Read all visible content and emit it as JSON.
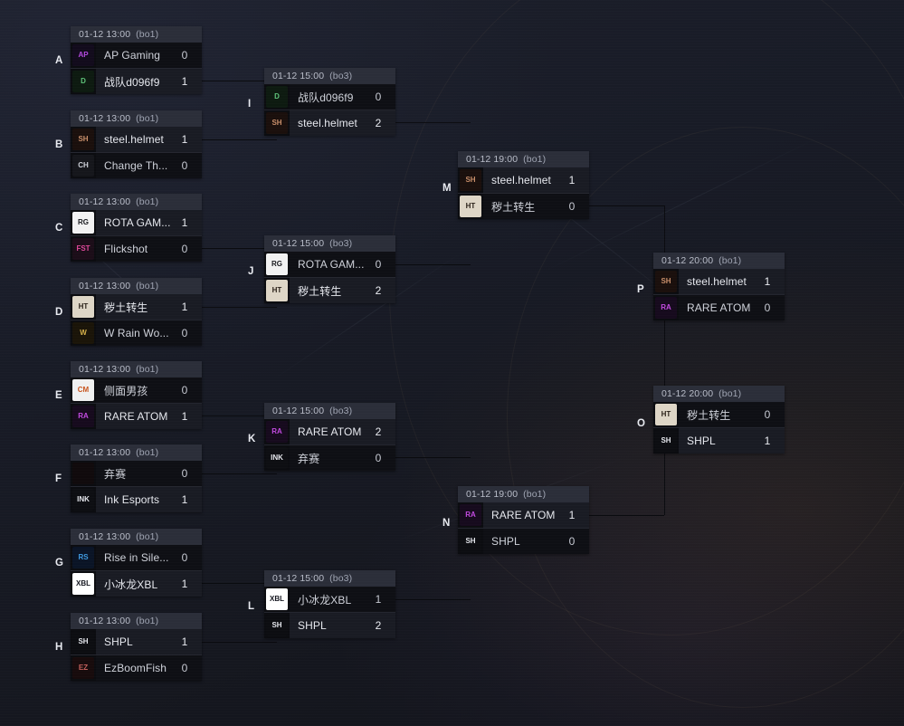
{
  "meta": {
    "view": "tournament-bracket",
    "accent_winner_row": "#191b23",
    "accent_loser_row": "#0e0f14",
    "header_bar": "#2b2e39",
    "background": "#181b26"
  },
  "seed_labels": [
    "A",
    "B",
    "C",
    "D",
    "E",
    "F",
    "G",
    "H"
  ],
  "node_labels": [
    "I",
    "J",
    "K",
    "L",
    "M",
    "N",
    "O",
    "P"
  ],
  "matches": [
    {
      "id": "A",
      "date": "01-12 13:00",
      "format": "(bo1)",
      "teams": [
        {
          "name": "AP Gaming",
          "score": "0",
          "winner": false,
          "logo": "ap-gaming-logo",
          "logo_text": "AP",
          "logo_bg": "#120b1c",
          "logo_fg": "#b44ae0"
        },
        {
          "name": "战队d096f9",
          "score": "1",
          "winner": true,
          "logo": "team-d096f9-logo",
          "logo_text": "D",
          "logo_bg": "#0d1a10",
          "logo_fg": "#5fc47a"
        }
      ]
    },
    {
      "id": "B",
      "date": "01-12 13:00",
      "format": "(bo1)",
      "teams": [
        {
          "name": "steel.helmet",
          "score": "1",
          "winner": true,
          "logo": "steel-helmet-logo",
          "logo_text": "SH",
          "logo_bg": "#1a0f0c",
          "logo_fg": "#c98f6a"
        },
        {
          "name": "Change Th...",
          "score": "0",
          "winner": false,
          "logo": "change-th-logo",
          "logo_text": "CH",
          "logo_bg": "#15161b",
          "logo_fg": "#cfd2da"
        }
      ]
    },
    {
      "id": "C",
      "date": "01-12 13:00",
      "format": "(bo1)",
      "teams": [
        {
          "name": "ROTA GAM...",
          "score": "1",
          "winner": true,
          "logo": "rota-gaming-logo",
          "logo_text": "RG",
          "logo_bg": "#f2f2f2",
          "logo_fg": "#15161b"
        },
        {
          "name": "Flickshot",
          "score": "0",
          "winner": false,
          "logo": "flickshot-logo",
          "logo_text": "FST",
          "logo_bg": "#1b0d18",
          "logo_fg": "#e0489a"
        }
      ]
    },
    {
      "id": "D",
      "date": "01-12 13:00",
      "format": "(bo1)",
      "teams": [
        {
          "name": "秽土转生",
          "score": "1",
          "winner": true,
          "logo": "huitu-zhuansheng-logo",
          "logo_text": "HT",
          "logo_bg": "#ded6c6",
          "logo_fg": "#2a2118"
        },
        {
          "name": "W Rain Wo...",
          "score": "0",
          "winner": false,
          "logo": "w-rain-logo",
          "logo_text": "W",
          "logo_bg": "#1a1408",
          "logo_fg": "#d8b24a"
        }
      ]
    },
    {
      "id": "E",
      "date": "01-12 13:00",
      "format": "(bo1)",
      "teams": [
        {
          "name": "侧面男孩",
          "score": "0",
          "winner": false,
          "logo": "cemian-nanhai-logo",
          "logo_text": "CM",
          "logo_bg": "#f0f0f0",
          "logo_fg": "#c8541e"
        },
        {
          "name": "RARE ATOM",
          "score": "1",
          "winner": true,
          "logo": "rare-atom-logo",
          "logo_text": "RA",
          "logo_bg": "#160a1d",
          "logo_fg": "#c24ae0"
        }
      ]
    },
    {
      "id": "F",
      "date": "01-12 13:00",
      "format": "(bo1)",
      "teams": [
        {
          "name": "弃赛",
          "score": "0",
          "winner": false,
          "logo": "forfeit-bull-logo",
          "logo_text": "",
          "logo_bg": "#100a0c",
          "logo_fg": "#c02334"
        },
        {
          "name": "Ink Esports",
          "score": "1",
          "winner": true,
          "logo": "ink-esports-logo",
          "logo_text": "INK",
          "logo_bg": "#0d0e12",
          "logo_fg": "#e6e8ee"
        }
      ]
    },
    {
      "id": "G",
      "date": "01-12 13:00",
      "format": "(bo1)",
      "teams": [
        {
          "name": "Rise in Sile...",
          "score": "0",
          "winner": false,
          "logo": "rise-in-silence-logo",
          "logo_text": "RS",
          "logo_bg": "#0a1426",
          "logo_fg": "#3f9ae0"
        },
        {
          "name": "小冰龙XBL",
          "score": "1",
          "winner": true,
          "logo": "xbl-logo",
          "logo_text": "XBL",
          "logo_bg": "#ffffff",
          "logo_fg": "#14161f"
        }
      ]
    },
    {
      "id": "H",
      "date": "01-12 13:00",
      "format": "(bo1)",
      "teams": [
        {
          "name": "SHPL",
          "score": "1",
          "winner": true,
          "logo": "shpl-logo",
          "logo_text": "SH",
          "logo_bg": "#0c0d11",
          "logo_fg": "#e6e8ee"
        },
        {
          "name": "EzBoomFish",
          "score": "0",
          "winner": false,
          "logo": "ezboomfish-logo",
          "logo_text": "EZ",
          "logo_bg": "#170b0c",
          "logo_fg": "#c4605c"
        }
      ]
    },
    {
      "id": "I",
      "date": "01-12 15:00",
      "format": "(bo3)",
      "teams": [
        {
          "name": "战队d096f9",
          "score": "0",
          "winner": false,
          "logo": "team-d096f9-logo",
          "logo_text": "D",
          "logo_bg": "#0d1a10",
          "logo_fg": "#5fc47a"
        },
        {
          "name": "steel.helmet",
          "score": "2",
          "winner": true,
          "logo": "steel-helmet-logo",
          "logo_text": "SH",
          "logo_bg": "#1a0f0c",
          "logo_fg": "#c98f6a"
        }
      ]
    },
    {
      "id": "J",
      "date": "01-12 15:00",
      "format": "(bo3)",
      "teams": [
        {
          "name": "ROTA GAM...",
          "score": "0",
          "winner": false,
          "logo": "rota-gaming-logo",
          "logo_text": "RG",
          "logo_bg": "#f2f2f2",
          "logo_fg": "#15161b"
        },
        {
          "name": "秽土转生",
          "score": "2",
          "winner": true,
          "logo": "huitu-zhuansheng-logo",
          "logo_text": "HT",
          "logo_bg": "#ded6c6",
          "logo_fg": "#2a2118"
        }
      ]
    },
    {
      "id": "K",
      "date": "01-12 15:00",
      "format": "(bo3)",
      "teams": [
        {
          "name": "RARE ATOM",
          "score": "2",
          "winner": true,
          "logo": "rare-atom-logo",
          "logo_text": "RA",
          "logo_bg": "#160a1d",
          "logo_fg": "#c24ae0"
        },
        {
          "name": "弃赛",
          "score": "0",
          "winner": false,
          "logo": "ink-esports-logo",
          "logo_text": "INK",
          "logo_bg": "#0d0e12",
          "logo_fg": "#e6e8ee"
        }
      ]
    },
    {
      "id": "L",
      "date": "01-12 15:00",
      "format": "(bo3)",
      "teams": [
        {
          "name": "小冰龙XBL",
          "score": "1",
          "winner": false,
          "logo": "xbl-logo",
          "logo_text": "XBL",
          "logo_bg": "#ffffff",
          "logo_fg": "#14161f"
        },
        {
          "name": "SHPL",
          "score": "2",
          "winner": true,
          "logo": "shpl-logo",
          "logo_text": "SH",
          "logo_bg": "#0c0d11",
          "logo_fg": "#e6e8ee"
        }
      ]
    },
    {
      "id": "M",
      "date": "01-12 19:00",
      "format": "(bo1)",
      "teams": [
        {
          "name": "steel.helmet",
          "score": "1",
          "winner": true,
          "logo": "steel-helmet-logo",
          "logo_text": "SH",
          "logo_bg": "#1a0f0c",
          "logo_fg": "#c98f6a"
        },
        {
          "name": "秽土转生",
          "score": "0",
          "winner": false,
          "logo": "huitu-zhuansheng-logo",
          "logo_text": "HT",
          "logo_bg": "#ded6c6",
          "logo_fg": "#2a2118"
        }
      ]
    },
    {
      "id": "N",
      "date": "01-12 19:00",
      "format": "(bo1)",
      "teams": [
        {
          "name": "RARE ATOM",
          "score": "1",
          "winner": true,
          "logo": "rare-atom-logo",
          "logo_text": "RA",
          "logo_bg": "#160a1d",
          "logo_fg": "#c24ae0"
        },
        {
          "name": "SHPL",
          "score": "0",
          "winner": false,
          "logo": "shpl-logo",
          "logo_text": "SH",
          "logo_bg": "#0c0d11",
          "logo_fg": "#e6e8ee"
        }
      ]
    },
    {
      "id": "P",
      "date": "01-12 20:00",
      "format": "(bo1)",
      "teams": [
        {
          "name": "steel.helmet",
          "score": "1",
          "winner": true,
          "logo": "steel-helmet-logo",
          "logo_text": "SH",
          "logo_bg": "#1a0f0c",
          "logo_fg": "#c98f6a"
        },
        {
          "name": "RARE ATOM",
          "score": "0",
          "winner": false,
          "logo": "rare-atom-logo",
          "logo_text": "RA",
          "logo_bg": "#160a1d",
          "logo_fg": "#c24ae0"
        }
      ]
    },
    {
      "id": "O",
      "date": "01-12 20:00",
      "format": "(bo1)",
      "teams": [
        {
          "name": "秽土转生",
          "score": "0",
          "winner": false,
          "logo": "huitu-zhuansheng-logo",
          "logo_text": "HT",
          "logo_bg": "#ded6c6",
          "logo_fg": "#2a2118"
        },
        {
          "name": "SHPL",
          "score": "1",
          "winner": true,
          "logo": "shpl-logo",
          "logo_text": "SH",
          "logo_bg": "#0c0d11",
          "logo_fg": "#e6e8ee"
        }
      ]
    }
  ]
}
